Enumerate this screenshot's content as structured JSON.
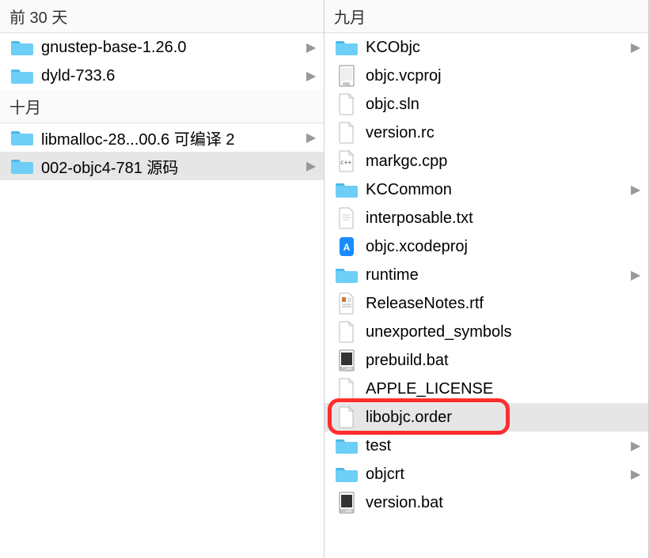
{
  "left": {
    "sections": [
      {
        "header": "前 30 天",
        "items": [
          {
            "name": "gnustep-base-1.26.0",
            "type": "folder",
            "hasChildren": true
          },
          {
            "name": "dyld-733.6",
            "type": "folder",
            "hasChildren": true
          }
        ]
      },
      {
        "header": "十月",
        "items": [
          {
            "name": "libmalloc-28...00.6 可编译 2",
            "type": "folder",
            "hasChildren": true
          },
          {
            "name": "002-objc4-781 源码",
            "type": "folder",
            "hasChildren": true,
            "selected": true
          }
        ]
      }
    ]
  },
  "right": {
    "header": "九月",
    "items": [
      {
        "name": "KCObjc",
        "type": "folder",
        "hasChildren": true
      },
      {
        "name": "objc.vcproj",
        "type": "xml"
      },
      {
        "name": "objc.sln",
        "type": "blank"
      },
      {
        "name": "version.rc",
        "type": "blank"
      },
      {
        "name": "markgc.cpp",
        "type": "cpp"
      },
      {
        "name": "KCCommon",
        "type": "folder",
        "hasChildren": true
      },
      {
        "name": "interposable.txt",
        "type": "txt"
      },
      {
        "name": "objc.xcodeproj",
        "type": "xcodeproj"
      },
      {
        "name": "runtime",
        "type": "folder",
        "hasChildren": true
      },
      {
        "name": "ReleaseNotes.rtf",
        "type": "rtf"
      },
      {
        "name": "unexported_symbols",
        "type": "blank"
      },
      {
        "name": "prebuild.bat",
        "type": "bat"
      },
      {
        "name": "APPLE_LICENSE",
        "type": "blank"
      },
      {
        "name": "libobjc.order",
        "type": "blank",
        "highlighted": true,
        "selected": true
      },
      {
        "name": "test",
        "type": "folder",
        "hasChildren": true
      },
      {
        "name": "objcrt",
        "type": "folder",
        "hasChildren": true
      },
      {
        "name": "version.bat",
        "type": "bat"
      }
    ]
  },
  "colors": {
    "folder": "#5ac8fa",
    "highlight": "#ff2d2d"
  }
}
